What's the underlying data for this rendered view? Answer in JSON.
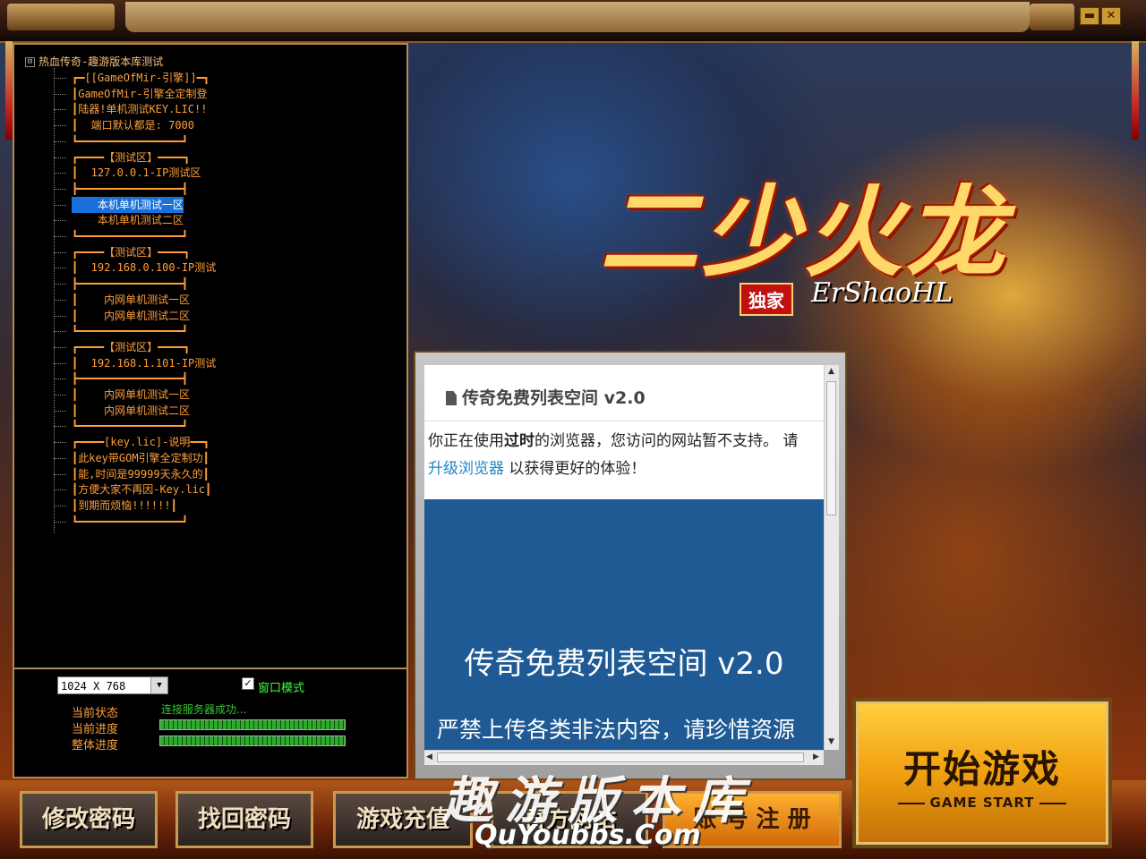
{
  "window": {
    "minimize_glyph": "▬",
    "close_glyph": "✕"
  },
  "tree": {
    "root_label": "热血传奇-趣游版本库测试",
    "root_toggle": "⊟",
    "items": [
      {
        "text": "┏━[[GameOfMir-引擎]]━┓"
      },
      {
        "text": "┃GameOfMir-引擎全定制登"
      },
      {
        "text": "┃陆器!单机测试KEY.LIC!!"
      },
      {
        "text": "┃  端口默认都是: 7000"
      },
      {
        "text": "┗━━━━━━━━━━━━━━━━┛"
      },
      {
        "text": "┏━━━━【测试区】━━━━┓"
      },
      {
        "text": "┃  127.0.0.1-IP测试区"
      },
      {
        "text": "┣━━━━━━━━━━━━━━━━┫"
      },
      {
        "text": "    本机单机测试一区",
        "selected": true
      },
      {
        "text": "    本机单机测试二区"
      },
      {
        "text": "┗━━━━━━━━━━━━━━━━┛"
      },
      {
        "text": "┏━━━━【测试区】━━━━┓"
      },
      {
        "text": "┃  192.168.0.100-IP测试"
      },
      {
        "text": "┣━━━━━━━━━━━━━━━━┫"
      },
      {
        "text": "┃    内网单机测试一区"
      },
      {
        "text": "┃    内网单机测试二区"
      },
      {
        "text": "┗━━━━━━━━━━━━━━━━┛"
      },
      {
        "text": "┏━━━━【测试区】━━━━┓"
      },
      {
        "text": "┃  192.168.1.101-IP测试"
      },
      {
        "text": "┣━━━━━━━━━━━━━━━━┫"
      },
      {
        "text": "┃    内网单机测试一区"
      },
      {
        "text": "┃    内网单机测试二区"
      },
      {
        "text": "┗━━━━━━━━━━━━━━━━┛"
      },
      {
        "text": "┏━━━━[key.lic]-说明━━┓"
      },
      {
        "text": "┃此key带GOM引擎全定制功┃"
      },
      {
        "text": "┃能,时间是99999天永久的┃"
      },
      {
        "text": "┃方便大家不再因-Key.lic┃"
      },
      {
        "text": "┃到期而烦恼!!!!!!┃"
      },
      {
        "text": "┗━━━━━━━━━━━━━━━━┛"
      }
    ]
  },
  "settings": {
    "resolution_value": "1024 X 768",
    "dropdown_arrow": "▼",
    "window_mode_checked": "✓",
    "window_mode_label": "窗口模式",
    "status_label": "当前状态",
    "status_value": "连接服务器成功...",
    "current_progress_label": "当前进度",
    "overall_progress_label": "整体进度",
    "current_progress": 1.0,
    "overall_progress": 1.0
  },
  "web": {
    "title": "传奇免费列表空间 v2.0",
    "msg_part1": "你正在使用",
    "msg_bold": "过时",
    "msg_part2": "的浏览器，您访问的网站暂不支持。 请",
    "msg_link": "升级浏览器",
    "msg_part3": " 以获得更好的体验！",
    "banner_title": "传奇免费列表空间 v2.0",
    "banner_warning": "严禁上传各类非法内容，请珍惜资源"
  },
  "logo": {
    "main": "二少火龙",
    "exclusive": "独家",
    "sub": "ErShaoHL"
  },
  "buttons": {
    "change_password": "修改密码",
    "recover_password": "找回密码",
    "recharge": "游戏充值",
    "official_site": "官方网站",
    "register": "账 号 注 册",
    "start_cn": "开始游戏",
    "start_en": "GAME START"
  },
  "watermark": {
    "cn": "趣游版本库",
    "en": "QuYoubbs.Com"
  },
  "colors": {
    "tree_text": "#ff9e3a",
    "selection": "#1a6fd8",
    "status_green": "#32c832",
    "web_banner": "#1f5a94",
    "link": "#1e86c8"
  }
}
